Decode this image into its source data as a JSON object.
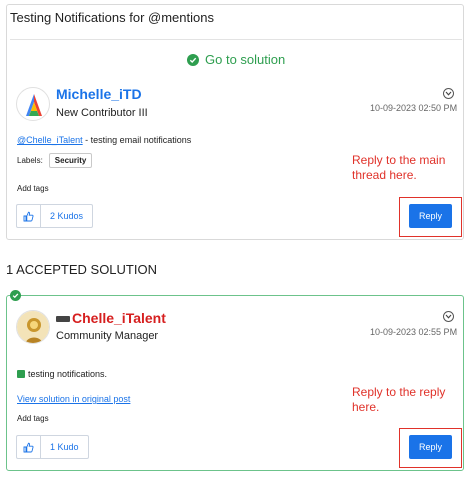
{
  "thread": {
    "title": "Testing Notifications for @mentions",
    "go_to_solution": "Go to solution"
  },
  "post1": {
    "author": "Michelle_iTD",
    "role": "New Contributor III",
    "timestamp": "10-09-2023 02:50 PM",
    "mention": "@Chelle_iTalent",
    "body": " - testing email notifications",
    "labels_label": "Labels:",
    "label_tag": "Security",
    "add_tags": "Add tags",
    "kudos": "2 Kudos",
    "reply": "Reply",
    "annotation": "Reply to the main thread here."
  },
  "accepted": {
    "heading": "1 ACCEPTED SOLUTION"
  },
  "post2": {
    "author": "Chelle_iTalent",
    "role": "Community Manager",
    "timestamp": "10-09-2023 02:55 PM",
    "body": "testing notifications.",
    "view_solution": "View solution in original post",
    "add_tags": "Add tags",
    "kudos": "1 Kudo",
    "reply": "Reply",
    "annotation": "Reply to the reply here."
  },
  "colors": {
    "accent": "#1a73e8",
    "success": "#2e9e4f",
    "annotation": "#e0322a"
  },
  "icons": [
    "check-circle-icon",
    "options-chevron-icon",
    "thumbs-up-icon",
    "rank-badge-icon"
  ]
}
